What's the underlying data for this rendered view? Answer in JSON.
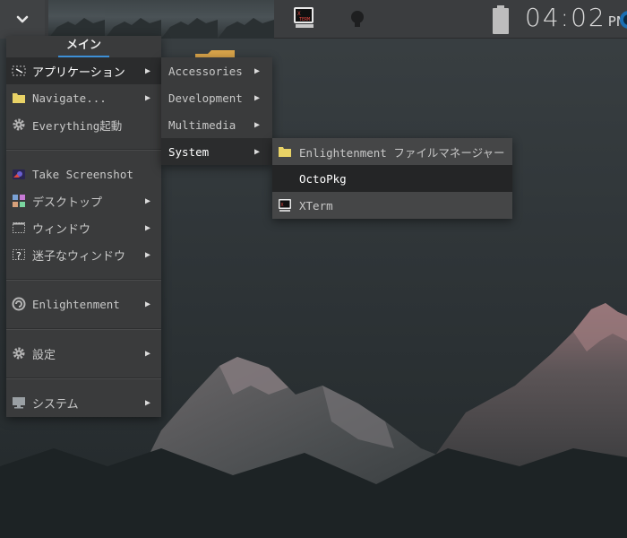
{
  "shelf": {
    "clock_hm": "04:02",
    "clock_ampm": "PM"
  },
  "main_menu": {
    "title": "メイン",
    "items": [
      {
        "label": "アプリケーション",
        "icon": "applications-icon",
        "submenu": true
      },
      {
        "label": "Navigate...",
        "icon": "folder-icon",
        "submenu": true
      },
      {
        "label": "Everything起動",
        "icon": "gear-icon",
        "submenu": false
      },
      {
        "label": "Take Screenshot",
        "icon": "screenshot-icon",
        "submenu": false
      },
      {
        "label": "デスクトップ",
        "icon": "desktop-icon",
        "submenu": true
      },
      {
        "label": "ウィンドウ",
        "icon": "window-icon",
        "submenu": true
      },
      {
        "label": "迷子なウィンドウ",
        "icon": "lost-window-icon",
        "submenu": true
      },
      {
        "label": "Enlightenment",
        "icon": "enlightenment-icon",
        "submenu": true
      },
      {
        "label": "設定",
        "icon": "gear-icon",
        "submenu": true
      },
      {
        "label": "システム",
        "icon": "monitor-icon",
        "submenu": true
      }
    ]
  },
  "app_menu": {
    "items": [
      {
        "label": "Accessories"
      },
      {
        "label": "Development"
      },
      {
        "label": "Multimedia"
      },
      {
        "label": "System"
      }
    ]
  },
  "system_menu": {
    "items": [
      {
        "label": "Enlightenment ファイルマネージャー",
        "icon": "folder-icon"
      },
      {
        "label": "OctoPkg",
        "icon": ""
      },
      {
        "label": "XTerm",
        "icon": "xterm-icon"
      }
    ]
  },
  "arrow_glyph": "▶",
  "colors": {
    "accent": "#3d8fd6",
    "menu_bg": "#3a3b3c",
    "highlight_bg": "#2b2c2d"
  }
}
